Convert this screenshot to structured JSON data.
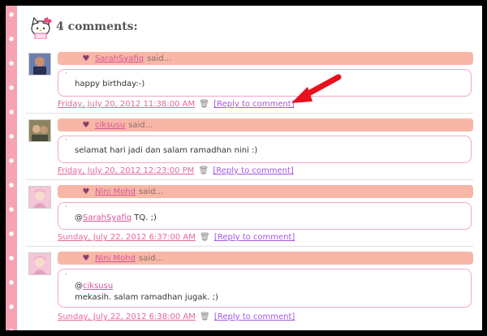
{
  "header": {
    "title": "4 comments:",
    "icon": "hello-kitty-icon"
  },
  "comments": [
    {
      "author": "SarahSyafiq",
      "said": "said...",
      "body_prefix": "",
      "body_link": "",
      "body": "happy birthday:-)",
      "timestamp": "Friday, July 20, 2012 11:38:00 AM",
      "reply": "[Reply to comment]"
    },
    {
      "author": "ciksusu",
      "said": "said...",
      "body_prefix": "",
      "body_link": "",
      "body": "selamat hari jadi dan salam ramadhan nini :)",
      "timestamp": "Friday, July 20, 2012 12:23:00 PM",
      "reply": "[Reply to comment]"
    },
    {
      "author": "Nini Mohd",
      "said": "said...",
      "body_prefix": "@",
      "body_link": "SarahSyafiq",
      "body": " TQ. ;)",
      "timestamp": "Sunday, July 22, 2012 6:37:00 AM",
      "reply": "[Reply to comment]"
    },
    {
      "author": "Nini Mohd",
      "said": "said...",
      "body_prefix": "@",
      "body_link": "ciksusu",
      "body": "mekasih. salam ramadhan jugak. ;)",
      "timestamp": "Sunday, July 22, 2012 6:38:00 AM",
      "reply": "[Reply to comment]"
    }
  ],
  "colors": {
    "bar": "#f7b6a6",
    "link": "#d9569a",
    "reply": "#a455e6",
    "border": "#f2a6c8",
    "arrow": "#e8101c"
  }
}
